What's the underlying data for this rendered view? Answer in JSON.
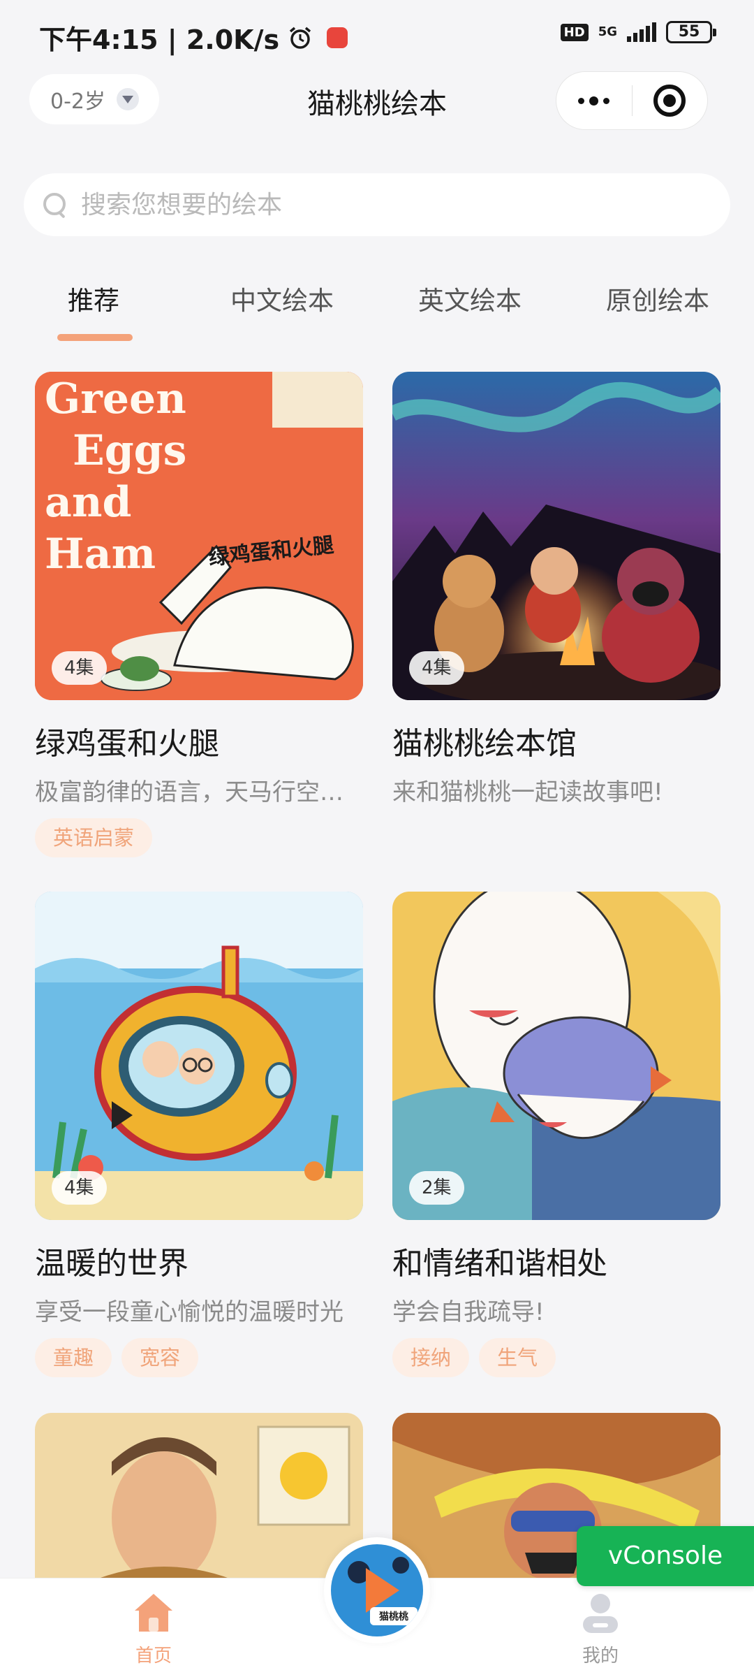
{
  "status_bar": {
    "left_text": "下午4:15 | 2.0K/s",
    "hd": "HD",
    "network": "5G",
    "battery": "55"
  },
  "nav": {
    "age_filter": "0-2岁",
    "title": "猫桃桃绘本"
  },
  "search": {
    "placeholder": "搜索您想要的绘本"
  },
  "tabs": [
    {
      "label": "推荐",
      "active": true
    },
    {
      "label": "中文绘本",
      "active": false
    },
    {
      "label": "英文绘本",
      "active": false
    },
    {
      "label": "原创绘本",
      "active": false
    }
  ],
  "books": [
    {
      "title": "绿鸡蛋和火腿",
      "description": "极富韵律的语言，天马行空的想象",
      "episodes": "4集",
      "tags": [
        "英语启蒙"
      ],
      "cover_text": [
        "Green",
        "Eggs",
        "and",
        "Ham"
      ],
      "cover_subtitle": "绿鸡蛋和火腿",
      "cover_color": "#ee6a43"
    },
    {
      "title": "猫桃桃绘本馆",
      "description": "来和猫桃桃一起读故事吧!",
      "episodes": "4集",
      "tags": [],
      "cover_color": "#2a2a55"
    },
    {
      "title": "温暖的世界",
      "description": "享受一段童心愉悦的温暖时光",
      "episodes": "4集",
      "tags": [
        "童趣",
        "宽容"
      ],
      "cover_color": "#7cc4e6"
    },
    {
      "title": "和情绪和谐相处",
      "description": "学会自我疏导!",
      "episodes": "2集",
      "tags": [
        "接纳",
        "生气"
      ],
      "cover_color": "#f2c75c"
    }
  ],
  "bottom_nav": {
    "home": "首页",
    "center_brand": "猫桃桃",
    "mine": "我的"
  },
  "vconsole": "vConsole",
  "colors": {
    "accent": "#f4a27a",
    "tag_bg": "#fdeee5",
    "tag_text": "#f0a47a",
    "vconsole": "#17b355"
  }
}
